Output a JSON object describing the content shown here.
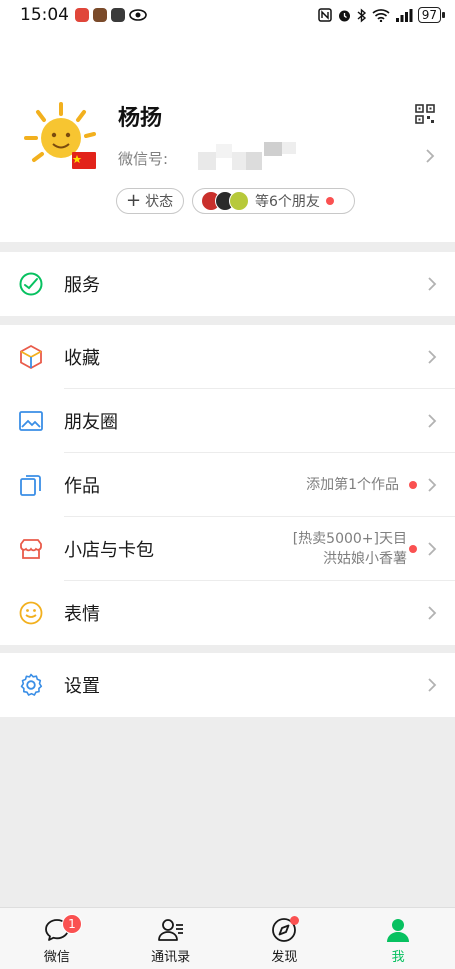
{
  "status_bar": {
    "time": "15:04",
    "battery": "97"
  },
  "profile": {
    "name": "杨扬",
    "wechat_id_label": "微信号:",
    "status_button": "状态",
    "friends_text": "等6个朋友"
  },
  "menu": {
    "services": "服务",
    "favorites": "收藏",
    "moments": "朋友圈",
    "works": "作品",
    "works_sub": "添加第1个作品",
    "shop": "小店与卡包",
    "shop_sub_line1": "[热卖5000+]天目",
    "shop_sub_line2": "洪姑娘小香薯",
    "stickers": "表情",
    "settings": "设置"
  },
  "tabbar": {
    "chats": "微信",
    "chats_badge": "1",
    "contacts": "通讯录",
    "discover": "发现",
    "me": "我"
  },
  "colors": {
    "accent": "#07c160",
    "badge": "#fa5151",
    "background": "#ededed"
  }
}
